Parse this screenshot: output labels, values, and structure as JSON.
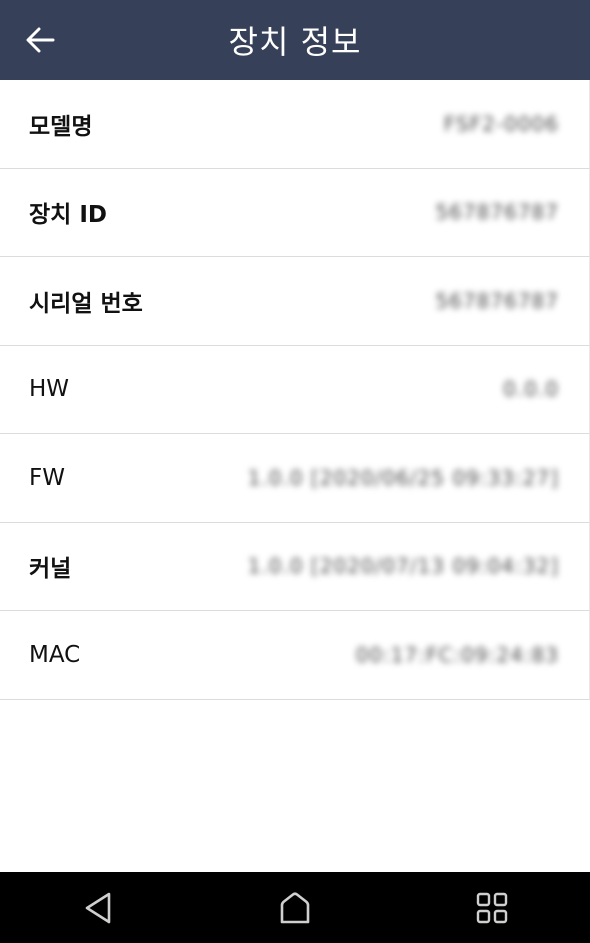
{
  "header": {
    "title": "장치 정보"
  },
  "rows": [
    {
      "label": "모델명",
      "value": "FSF2-0006"
    },
    {
      "label": "장치 ID",
      "value": "567876787"
    },
    {
      "label": "시리얼 번호",
      "value": "567876787"
    },
    {
      "label": "HW",
      "value": "0.0.0"
    },
    {
      "label": "FW",
      "value": "1.0.0 [2020/06/25 09:33:27]"
    },
    {
      "label": "커널",
      "value": "1.0.0 [2020/07/13 09:04:32]"
    },
    {
      "label": "MAC",
      "value": "00:17:FC:09:24:83"
    }
  ],
  "icons": {
    "back": "back-arrow-icon",
    "nav_back": "triangle-back-icon",
    "nav_home": "home-icon",
    "nav_recents": "grid-recents-icon"
  },
  "colors": {
    "header_bg": "#364058",
    "navbar_bg": "#000000",
    "divider": "#dcdcdc"
  }
}
